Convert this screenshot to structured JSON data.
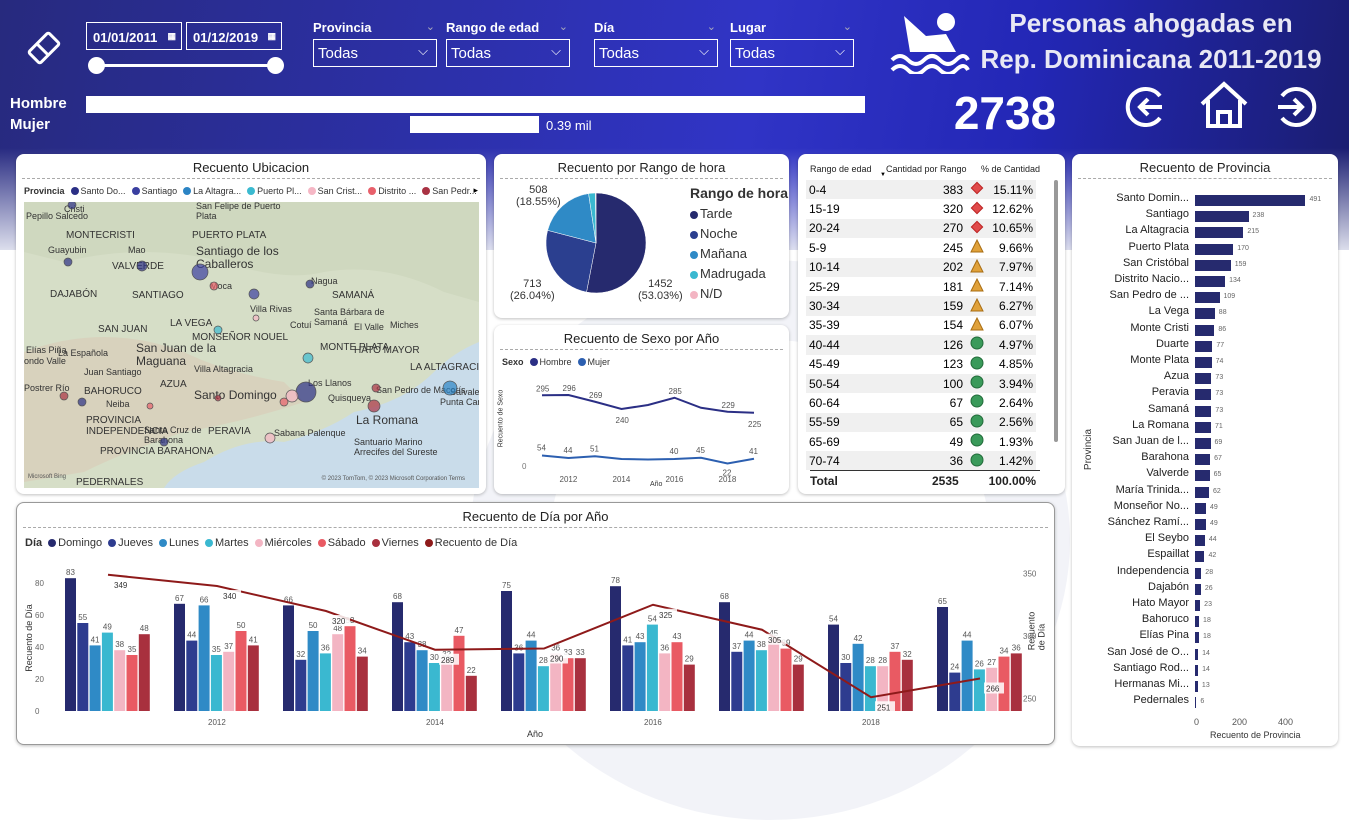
{
  "header": {
    "title_line1": "Personas ahogadas en",
    "title_line2": "Rep. Dominicana 2011-2019",
    "total": "2738",
    "date_start": "01/01/2011",
    "date_end": "01/12/2019",
    "gender": [
      {
        "label": "Hombre",
        "value": 2350
      },
      {
        "label": "Mujer",
        "value": 390,
        "text": "0.39 mil"
      }
    ],
    "slicers": [
      {
        "label": "Provincia",
        "value": "Todas"
      },
      {
        "label": "Rango de edad",
        "value": "Todas"
      },
      {
        "label": "Día",
        "value": "Todas"
      },
      {
        "label": "Lugar",
        "value": "Todas"
      }
    ],
    "icons": [
      "calendar-icon",
      "eraser-icon",
      "swimmer-icon",
      "back-icon",
      "home-icon",
      "forward-icon"
    ]
  },
  "map": {
    "title": "Recuento Ubicacion",
    "legend_label": "Provincia",
    "legend_items": [
      "Santo Do...",
      "Santiago",
      "La Altagra...",
      "Puerto Pl...",
      "San Crist...",
      "Distrito ...",
      "San Pedr..."
    ],
    "legend_colors": [
      "#2b2f85",
      "#3a3fa0",
      "#2c84c4",
      "#3bbad0",
      "#f5b7c5",
      "#e8606b",
      "#a93243"
    ],
    "places": [
      "Pepillo Salcedo",
      "Cristi",
      "MONTECRISTI",
      "San Felipe de Puerto Plata",
      "PUERTO PLATA",
      "Guayubin",
      "Mao",
      "Santiago de los Caballeros",
      "VALVERDE",
      "Nagua",
      "DAJABÓN",
      "SANTIAGO",
      "Moca",
      "SAMANÁ",
      "Santa Bárbara de Samaná",
      "LA VEGA",
      "Villa Rivas",
      "Cotuí",
      "El Valle",
      "Miches",
      "SAN JUAN",
      "San Juan de la Maguana",
      "MONSEÑOR NOUEL",
      "MONTE PLATA",
      "HATO MAYOR",
      "Elías Piña",
      "La Española",
      "ondo Valle",
      "Juan Santiago",
      "Villa Altagracia",
      "LA ALTAGRACIA",
      "AZUA",
      "Los Llanos",
      "Postrer Río",
      "BAHORUCO",
      "Santo Domingo",
      "Quisqueya",
      "San Pedro de Macorís",
      "Neiba",
      "La Romana",
      "Salvaleón de Higüey",
      "Punta Cana",
      "PROVINCIA INDEPENDENCIA",
      "Santa Cruz de Barahona",
      "PERAVIA",
      "Sabana Palenque",
      "Santuario Marino Arrecifes del Sureste",
      "PROVINCIA BARAHONA",
      "PEDERNALES"
    ],
    "attrib": "© 2023 TomTom, © 2023 Microsoft Corporation  Terms",
    "brand": "Microsoft Bing"
  },
  "pie": {
    "title": "Recuento por Rango de hora",
    "legend_title": "Rango de hora",
    "slices": [
      {
        "label": "Tarde",
        "value": 1452,
        "pct": "53.03%",
        "color": "#262a6e"
      },
      {
        "label": "Noche",
        "value": 713,
        "pct": "26.04%",
        "color": "#2b3f8f"
      },
      {
        "label": "Mañana",
        "value": 508,
        "pct": "18.55%",
        "color": "#2f8ac6"
      },
      {
        "label": "Madrugada",
        "value": 60,
        "pct": "2.19%",
        "color": "#3ab8d0"
      },
      {
        "label": "N/D",
        "value": 5,
        "pct": "0.18%",
        "color": "#f3b5c3"
      }
    ],
    "lbl_tarde": "1452",
    "lbl_tarde_pct": "(53.03%)",
    "lbl_noche": "713",
    "lbl_noche_pct": "(26.04%)",
    "lbl_manana": "508",
    "lbl_manana_pct": "(18.55%)"
  },
  "sexo": {
    "title": "Recuento de Sexo por Año",
    "legend_label": "Sexo",
    "series_labels": [
      "Hombre",
      "Mujer"
    ],
    "ylabel": "Recuento de Sexo",
    "xlabel": "Año",
    "ytick": "0",
    "xticks": [
      "2012",
      "2014",
      "2016",
      "2018"
    ],
    "hombre": [
      295,
      296,
      269,
      240,
      256,
      285,
      245,
      229,
      225
    ],
    "mujer": [
      54,
      44,
      51,
      40,
      38,
      40,
      45,
      22,
      41
    ],
    "hombre_labels": [
      "295",
      "296",
      "269",
      "240",
      "285",
      "229",
      "225"
    ],
    "mujer_labels": [
      "54",
      "44",
      "51",
      "40",
      "45",
      "22",
      "41"
    ]
  },
  "agetable": {
    "headers": [
      "Rango de edad",
      "Cantidad por Rango",
      "% de Cantidad"
    ],
    "rows": [
      {
        "r": "0-4",
        "c": "383",
        "p": "15.11%",
        "i": "red"
      },
      {
        "r": "15-19",
        "c": "320",
        "p": "12.62%",
        "i": "red"
      },
      {
        "r": "20-24",
        "c": "270",
        "p": "10.65%",
        "i": "red"
      },
      {
        "r": "5-9",
        "c": "245",
        "p": "9.66%",
        "i": "tri"
      },
      {
        "r": "10-14",
        "c": "202",
        "p": "7.97%",
        "i": "tri"
      },
      {
        "r": "25-29",
        "c": "181",
        "p": "7.14%",
        "i": "tri"
      },
      {
        "r": "30-34",
        "c": "159",
        "p": "6.27%",
        "i": "tri"
      },
      {
        "r": "35-39",
        "c": "154",
        "p": "6.07%",
        "i": "tri"
      },
      {
        "r": "40-44",
        "c": "126",
        "p": "4.97%",
        "i": "g"
      },
      {
        "r": "45-49",
        "c": "123",
        "p": "4.85%",
        "i": "g"
      },
      {
        "r": "50-54",
        "c": "100",
        "p": "3.94%",
        "i": "g"
      },
      {
        "r": "60-64",
        "c": "67",
        "p": "2.64%",
        "i": "g"
      },
      {
        "r": "55-59",
        "c": "65",
        "p": "2.56%",
        "i": "g"
      },
      {
        "r": "65-69",
        "c": "49",
        "p": "1.93%",
        "i": "g"
      },
      {
        "r": "70-74",
        "c": "36",
        "p": "1.42%",
        "i": "g"
      }
    ],
    "total_label": "Total",
    "total_count": "2535",
    "total_pct": "100.00%"
  },
  "provincia": {
    "title": "Recuento de Provincia",
    "ylabel": "Provincia",
    "xlabel": "Recuento de Provincia",
    "xticks": [
      "0",
      "200",
      "400"
    ],
    "items": [
      {
        "n": "Santo Domin...",
        "v": 491
      },
      {
        "n": "Santiago",
        "v": 238
      },
      {
        "n": "La Altagracia",
        "v": 215
      },
      {
        "n": "Puerto Plata",
        "v": 170
      },
      {
        "n": "San Cristóbal",
        "v": 159
      },
      {
        "n": "Distrito Nacio...",
        "v": 134
      },
      {
        "n": "San Pedro de ...",
        "v": 109
      },
      {
        "n": "La Vega",
        "v": 88
      },
      {
        "n": "Monte Cristi",
        "v": 86
      },
      {
        "n": "Duarte",
        "v": 77
      },
      {
        "n": "Monte Plata",
        "v": 74
      },
      {
        "n": "Azua",
        "v": 73
      },
      {
        "n": "Peravia",
        "v": 73
      },
      {
        "n": "Samaná",
        "v": 73
      },
      {
        "n": "La Romana",
        "v": 71
      },
      {
        "n": "San Juan de l...",
        "v": 69
      },
      {
        "n": "Barahona",
        "v": 67
      },
      {
        "n": "Valverde",
        "v": 65
      },
      {
        "n": "María Trinida...",
        "v": 62
      },
      {
        "n": "Monseñor No...",
        "v": 49
      },
      {
        "n": "Sánchez Ramí...",
        "v": 49
      },
      {
        "n": "El Seybo",
        "v": 44
      },
      {
        "n": "Espaillat",
        "v": 42
      },
      {
        "n": "Independencia",
        "v": 28
      },
      {
        "n": "Dajabón",
        "v": 26
      },
      {
        "n": "Hato Mayor",
        "v": 23
      },
      {
        "n": "Bahoruco",
        "v": 18
      },
      {
        "n": "Elías Pina",
        "v": 18
      },
      {
        "n": "San José de O...",
        "v": 14
      },
      {
        "n": "Santiago Rod...",
        "v": 14
      },
      {
        "n": "Hermanas Mi...",
        "v": 13
      },
      {
        "n": "Pedernales",
        "v": 6
      }
    ]
  },
  "chart_data": [
    {
      "type": "bar",
      "title": "Recuento de Día por Año",
      "xlabel": "Año",
      "ylabel": "Recuento de Día",
      "y2label": "Recuento de Día",
      "legend_label": "Día",
      "categories": [
        "2011",
        "2012",
        "2013",
        "2014",
        "2015",
        "2016",
        "2017",
        "2018",
        "2019"
      ],
      "xticks": [
        "2012",
        "2014",
        "2016",
        "2018"
      ],
      "yticks": [
        "0",
        "20",
        "40",
        "60",
        "80"
      ],
      "y2ticks": [
        "250",
        "300",
        "350"
      ],
      "series": [
        {
          "name": "Domingo",
          "color": "#262a6e",
          "values": [
            83,
            67,
            66,
            68,
            75,
            78,
            68,
            54,
            65
          ]
        },
        {
          "name": "Jueves",
          "color": "#2e3c8f",
          "values": [
            55,
            44,
            32,
            43,
            36,
            41,
            37,
            30,
            24
          ]
        },
        {
          "name": "Lunes",
          "color": "#2f8ac6",
          "values": [
            41,
            66,
            50,
            38,
            44,
            43,
            44,
            42,
            44
          ]
        },
        {
          "name": "Martes",
          "color": "#3ab8d0",
          "values": [
            49,
            35,
            36,
            30,
            28,
            54,
            38,
            28,
            26
          ]
        },
        {
          "name": "Miércoles",
          "color": "#f3b5c3",
          "values": [
            38,
            37,
            48,
            32,
            36,
            36,
            45,
            28,
            27
          ]
        },
        {
          "name": "Sábado",
          "color": "#e95a63",
          "values": [
            35,
            50,
            53,
            47,
            33,
            43,
            39,
            37,
            34
          ]
        },
        {
          "name": "Viernes",
          "color": "#a8303e",
          "values": [
            48,
            41,
            34,
            22,
            33,
            29,
            29,
            32,
            36
          ]
        }
      ],
      "line": {
        "name": "Recuento de Día",
        "color": "#8e1a1a",
        "values": [
          349,
          340,
          320,
          289,
          290,
          325,
          305,
          251,
          266
        ]
      },
      "y2lim": [
        240,
        360
      ],
      "ylim": [
        0,
        90
      ]
    }
  ]
}
